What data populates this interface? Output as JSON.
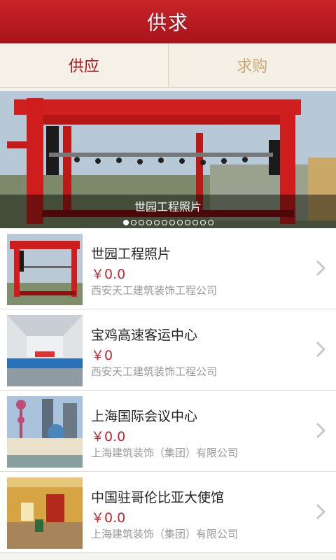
{
  "header": {
    "title": "供求"
  },
  "tabs": [
    {
      "label": "供应",
      "active": true
    },
    {
      "label": "求购",
      "active": false
    }
  ],
  "banner": {
    "caption": "世园工程照片",
    "slide_count": 12,
    "active_slide": 0
  },
  "list": [
    {
      "title": "世园工程照片",
      "price": "￥0.0",
      "company": "西安天工建筑装饰工程公司",
      "thumb": "stage"
    },
    {
      "title": "宝鸡高速客运中心",
      "price": "￥0",
      "company": "西安天工建筑装饰工程公司",
      "thumb": "hall"
    },
    {
      "title": "上海国际会议中心",
      "price": "￥0.0",
      "company": "上海建筑装饰（集团）有限公司",
      "thumb": "city"
    },
    {
      "title": "中国驻哥伦比亚大使馆",
      "price": "￥0.0",
      "company": "上海建筑装饰（集团）有限公司",
      "thumb": "lobby"
    }
  ],
  "colors": {
    "header": "#b31b20",
    "accent": "#a8141a",
    "price": "#c0262c",
    "tab_inactive": "#c9a674"
  }
}
